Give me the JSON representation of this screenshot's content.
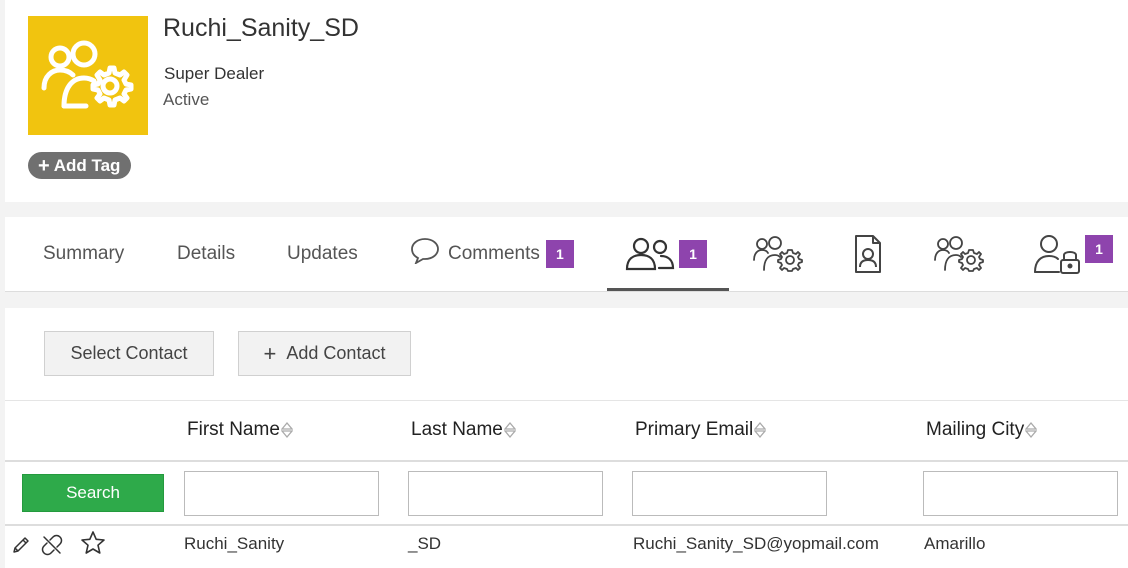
{
  "header": {
    "title": "Ruchi_Sanity_SD",
    "subtitle": "Super Dealer",
    "status": "Active",
    "add_tag_label": "Add Tag",
    "add_tag_plus": "+",
    "avatar_icon": "users-gear-icon",
    "avatar_color": "#f1c40f"
  },
  "tabs": [
    {
      "label": "Summary"
    },
    {
      "label": "Details"
    },
    {
      "label": "Updates"
    },
    {
      "label": "Comments",
      "badge": "1",
      "icon": "comment-icon"
    },
    {
      "label": "",
      "badge": "1",
      "icon": "contacts-icon",
      "active": true
    },
    {
      "label": "",
      "icon": "users-gear-icon"
    },
    {
      "label": "",
      "icon": "document-user-icon"
    },
    {
      "label": "",
      "icon": "users-gear-icon"
    },
    {
      "label": "",
      "badge": "1",
      "icon": "user-lock-icon"
    }
  ],
  "actions": {
    "select_contact": "Select Contact",
    "add_contact": "Add Contact",
    "add_plus": "+"
  },
  "table": {
    "columns": [
      "First Name",
      "Last Name",
      "Primary Email",
      "Mailing City"
    ],
    "search_label": "Search",
    "rows": [
      {
        "first_name": "Ruchi_Sanity",
        "last_name": "_SD",
        "email": "Ruchi_Sanity_SD@yopmail.com",
        "city": "Amarillo",
        "icons": [
          "edit-icon",
          "unlink-icon",
          "star-icon"
        ]
      }
    ]
  },
  "colors": {
    "badge": "#8e44ad",
    "search_button": "#2eaa4a",
    "tag_background": "#707070"
  }
}
